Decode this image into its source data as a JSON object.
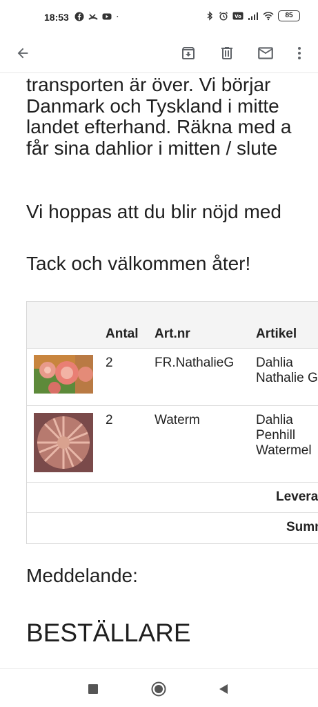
{
  "status_bar": {
    "time": "18:53",
    "battery": "85",
    "icons": [
      "facebook-icon",
      "missed-call-icon",
      "youtube-icon",
      "dot-icon",
      "bluetooth-icon",
      "alarm-icon",
      "volte-icon",
      "signal-icon",
      "wifi-icon",
      "battery-icon"
    ]
  },
  "app_bar": {
    "icons": [
      "back-arrow-icon",
      "archive-icon",
      "delete-icon",
      "mail-icon",
      "more-vert-icon"
    ]
  },
  "email": {
    "paragraph1": [
      "transporten är över.  Vi börjar",
      "Danmark och Tyskland i mitte",
      "landet efterhand. Räkna med a",
      "får sina dahlior i mitten / slute"
    ],
    "paragraph2": "Vi hoppas att du blir nöjd med",
    "paragraph3": "Tack och välkommen åter!",
    "table": {
      "headers": {
        "antal": "Antal",
        "artnr": "Art.nr",
        "artikel": "Artikel"
      },
      "rows": [
        {
          "antal": "2",
          "artnr": "FR.NathalieG",
          "artikel": [
            "Dahlia",
            "Nathalie G"
          ]
        },
        {
          "antal": "2",
          "artnr": "Waterm",
          "artikel": [
            "Dahlia",
            "Penhill",
            "Watermel"
          ]
        }
      ],
      "summary": [
        {
          "label": "Leverans"
        },
        {
          "label": "Summa"
        }
      ]
    },
    "meddelande": "Meddelande:",
    "bestallare": "BESTÄLLARE"
  },
  "nav_bar": {
    "icons": [
      "recents-icon",
      "home-icon",
      "back-icon"
    ]
  },
  "colors": {
    "text": "#1f1f1f",
    "icon": "#5f6368",
    "table_header_bg": "#f4f4f4",
    "divider": "#dcdcdc"
  }
}
